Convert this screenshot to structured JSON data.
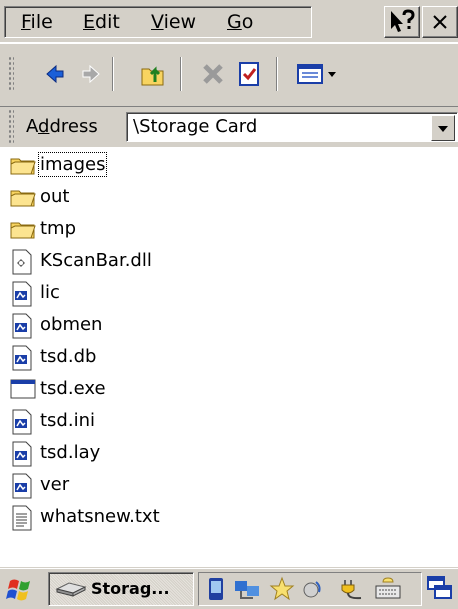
{
  "menubar": {
    "items": [
      {
        "mnemonic": "F",
        "rest": "ile"
      },
      {
        "mnemonic": "E",
        "rest": "dit"
      },
      {
        "mnemonic": "V",
        "rest": "iew"
      },
      {
        "mnemonic": "G",
        "rest": "o"
      }
    ],
    "help_icon": "whats-this-help-icon",
    "close_icon": "close-icon"
  },
  "toolbar": {
    "buttons": [
      "back-icon",
      "forward-icon",
      "up-folder-icon",
      "delete-icon",
      "properties-icon",
      "views-icon"
    ]
  },
  "address": {
    "label_pre": "A",
    "label_mnemonic": "d",
    "label_post": "dress",
    "value": "\\Storage Card"
  },
  "files": [
    {
      "name": "images",
      "icon": "folder-icon",
      "focused": true
    },
    {
      "name": "out",
      "icon": "folder-icon"
    },
    {
      "name": "tmp",
      "icon": "folder-icon"
    },
    {
      "name": "KScanBar.dll",
      "icon": "dll-file-icon"
    },
    {
      "name": "lic",
      "icon": "generic-file-icon"
    },
    {
      "name": "obmen",
      "icon": "generic-file-icon"
    },
    {
      "name": "tsd.db",
      "icon": "generic-file-icon"
    },
    {
      "name": "tsd.exe",
      "icon": "exe-file-icon"
    },
    {
      "name": "tsd.ini",
      "icon": "generic-file-icon"
    },
    {
      "name": "tsd.lay",
      "icon": "generic-file-icon"
    },
    {
      "name": "ver",
      "icon": "generic-file-icon"
    },
    {
      "name": "whatsnew.txt",
      "icon": "text-file-icon"
    }
  ],
  "taskbar": {
    "start_icon": "windows-start-icon",
    "task_label": "Storag...",
    "task_icon": "storage-card-icon",
    "tray_icons": [
      "pda-icon",
      "network-icon",
      "star-icon",
      "volume-icon",
      "power-plug-icon",
      "keyboard-icon"
    ],
    "desktop_icon": "switch-windows-icon"
  },
  "colors": {
    "chrome": "#d4d0c8",
    "folder": "#f8d460",
    "selection_blue": "#0a246a"
  }
}
